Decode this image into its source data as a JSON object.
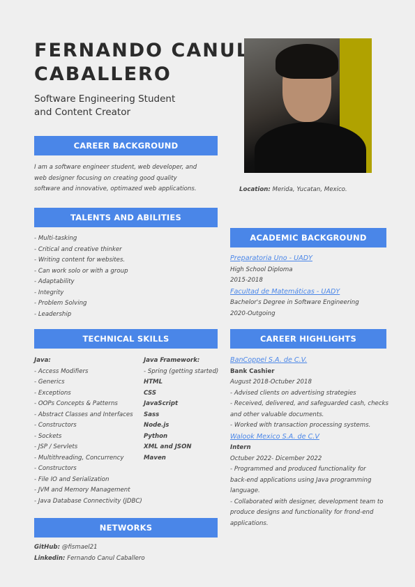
{
  "name": "FERNANDO CANUL CABALLERO",
  "name_line1": "FERNANDO CANUL",
  "name_line2": "CABALLERO",
  "subtitle_line1": "Software Engineering Student",
  "subtitle_line2": "and Content Creator",
  "location_label": "Location:",
  "location": " Merida, Yucatan, Mexico.",
  "career_background": {
    "title": "CAREER BACKGROUND",
    "lines": [
      "I am a software engineer student, web developer, and",
      "web designer focusing on creating good quality",
      "software and innovative, optimazed web applications."
    ]
  },
  "talents": {
    "title": "TALENTS AND ABILITIES",
    "items": [
      "- Multi-tasking",
      "- Critical and creative thinker",
      "- Writing content for websites.",
      "- Can work solo or with a group",
      "- Adaptability",
      "- Integrity",
      "- Problem Solving",
      "- Leadership"
    ]
  },
  "technical": {
    "title": "TECHNICAL SKILLS",
    "java_label": "Java:",
    "java": [
      "- Access Modifiers",
      "- Generics",
      "- Exceptions",
      "- OOPs Concepts & Patterns",
      "- Abstract Classes and Interfaces",
      "- Constructors",
      "- Sockets",
      "- JSP / Servlets",
      "- Multithreading, Concurrency",
      "- Constructors",
      "- File IO and Serialization",
      "- JVM and Memory Management",
      "- Java Database Connectivity (JDBC)"
    ],
    "framework_label": "Java Framework:",
    "framework": "- Spring (getting started)",
    "others": [
      "HTML",
      "CSS",
      "JavaScript",
      "Sass",
      "Node.js",
      "Python",
      "XML and JSON",
      "Maven"
    ]
  },
  "networks": {
    "title": "NETWORKS",
    "github_label": "GitHub:",
    "github": " @fismael21",
    "linkedin_label": "Linkedin:",
    "linkedin": " Fernando Canul Caballero"
  },
  "academic": {
    "title": "ACADEMIC BACKGROUND",
    "entries": [
      {
        "school": "Preparatoria Uno - UADY",
        "degree": "High School Diploma",
        "years": "2015-2018"
      },
      {
        "school": "Facultad de Matemáticas - UADY",
        "degree": "Bachelor's Degree in Software Engineering",
        "years": "2020-Outgoing"
      }
    ]
  },
  "highlights": {
    "title": "CAREER HIGHLIGHTS",
    "jobs": [
      {
        "company": "BanCoppel S.A. de C.V.",
        "role": "Bank Cashier",
        "dates": "August 2018-Octuber 2018",
        "lines": [
          "- Advised clients on advertising strategies",
          "- Received, delivered, and safeguarded cash, checks",
          "and other valuable documents.",
          "- Worked with transaction processing systems."
        ]
      },
      {
        "company": "Walook Mexico S.A. de C.V",
        "role": "Intern",
        "dates": "Octuber 2022- Dicember 2022",
        "lines": [
          "- Programmed and produced functionality for",
          "back-end applications using Java programming",
          "language.",
          "- Collaborated with designer, development team to",
          "produce designs and functionality for frond-end",
          "applications."
        ]
      }
    ]
  },
  "colors": {
    "accent": "#4a86e8",
    "olive": "#b0a200"
  }
}
